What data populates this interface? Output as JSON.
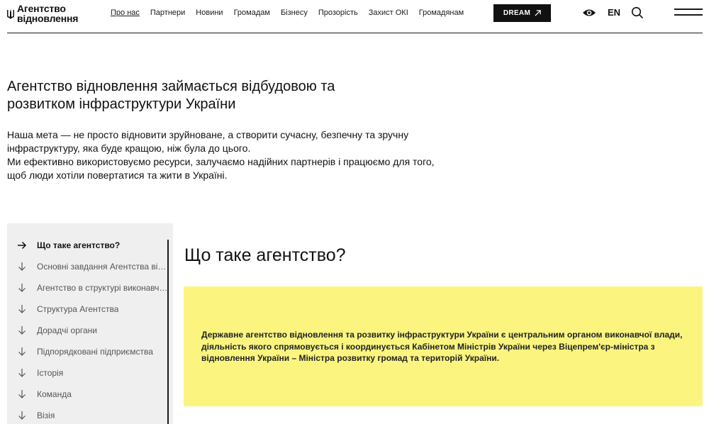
{
  "header": {
    "logo_line1": "Агентство",
    "logo_line2": "відновлення",
    "nav": [
      {
        "label": "Про нас",
        "active": true
      },
      {
        "label": "Партнери"
      },
      {
        "label": "Новини"
      },
      {
        "label": "Громадам"
      },
      {
        "label": "Бізнесу"
      },
      {
        "label": "Прозорість"
      },
      {
        "label": "Захист ОКІ"
      },
      {
        "label": "Громадянам"
      }
    ],
    "dream_label": "DREAM",
    "lang_label": "EN",
    "icons": [
      "trident-logo-icon",
      "arrow-up-right-icon",
      "eye-icon",
      "search-icon",
      "menu-icon"
    ]
  },
  "intro": {
    "title": "Агентство відновлення займається відбудовою та розвитком інфраструктури України",
    "paragraph1": "Наша мета — не просто відновити зруйноване, а створити сучасну, безпечну та зручну інфраструктуру, яка буде кращою, ніж була до цього.",
    "paragraph2": "Ми ефективно використовуємо ресурси, залучаємо надійних партнерів і працюємо для того, щоб люди хотіли повертатися та жити в Україні."
  },
  "sidebar": {
    "items": [
      {
        "label": "Що таке агентство?",
        "active": true,
        "icon": "arrow-right-icon"
      },
      {
        "label": "Основні завдання Агентства відновлення",
        "icon": "arrow-down-icon"
      },
      {
        "label": "Агентство в структурі виконавчої влади",
        "icon": "arrow-down-icon"
      },
      {
        "label": "Структура Агентства",
        "icon": "arrow-down-icon"
      },
      {
        "label": "Дорадчі органи",
        "icon": "arrow-down-icon"
      },
      {
        "label": "Підпорядковані підприємства",
        "icon": "arrow-down-icon"
      },
      {
        "label": "Історія",
        "icon": "arrow-down-icon"
      },
      {
        "label": "Команда",
        "icon": "arrow-down-icon"
      },
      {
        "label": "Візія",
        "icon": "arrow-down-icon"
      }
    ]
  },
  "main": {
    "section_title": "Що таке агентство?",
    "callout_text": "Державне агентство відновлення та розвитку інфраструктури України є центральним органом виконавчої влади, діяльність якого спрямовується і координується Кабінетом Міністрів України через Віцепрем'єр-міністра з відновлення України – Міністра розвитку громад та територій України."
  },
  "colors": {
    "accent_yellow": "#fbf580",
    "dark": "#111111",
    "sidebar_bg": "#efefef"
  }
}
